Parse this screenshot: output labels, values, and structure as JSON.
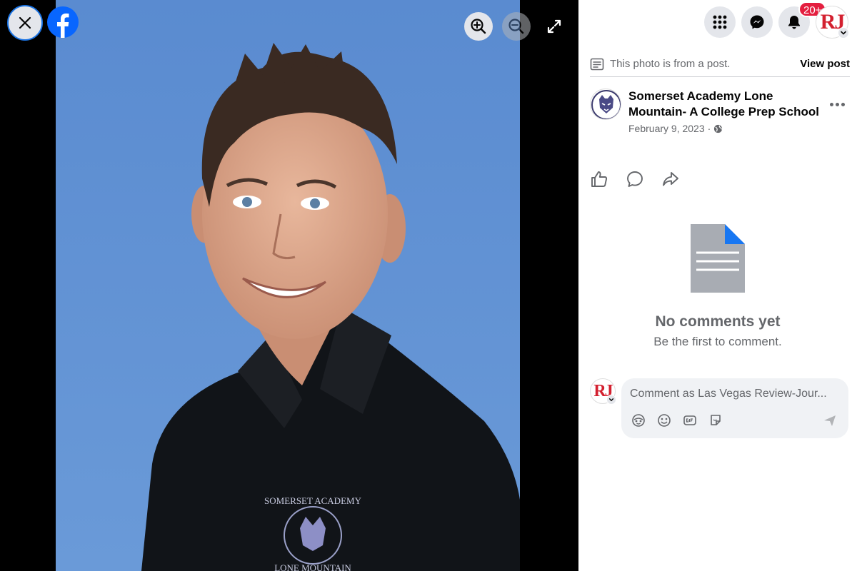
{
  "viewer": {
    "close_icon": "close-icon",
    "logo_icon": "facebook-logo",
    "zoom_in_icon": "zoom-in-icon",
    "zoom_out_icon": "zoom-out-icon",
    "expand_icon": "expand-icon",
    "photo_shirt_logo_text": [
      "SOMERSET ACADEMY",
      "LONE MOUNTAIN"
    ]
  },
  "topbar": {
    "menu_icon": "menu-grid-icon",
    "messenger_icon": "messenger-icon",
    "notifications_icon": "bell-icon",
    "notifications_badge": "20+",
    "account_avatar_text": "RJ"
  },
  "notice": {
    "text": "This photo is from a post.",
    "view_post_label": "View post"
  },
  "post": {
    "page_name": "Somerset Academy Lone Mountain- A College Prep School",
    "date": "February 9, 2023",
    "separator": "·",
    "privacy_icon": "globe-icon"
  },
  "actions": {
    "like_icon": "like-icon",
    "comment_icon": "comment-icon",
    "share_icon": "share-icon"
  },
  "empty_state": {
    "title": "No comments yet",
    "subtitle": "Be the first to comment."
  },
  "composer": {
    "avatar_text": "RJ",
    "placeholder": "Comment as Las Vegas Review-Jour..."
  },
  "colors": {
    "accent": "#0866ff",
    "badge": "#e41e3f",
    "brand_rj": "#d3202f",
    "photo_background": "#5b8ed1"
  }
}
